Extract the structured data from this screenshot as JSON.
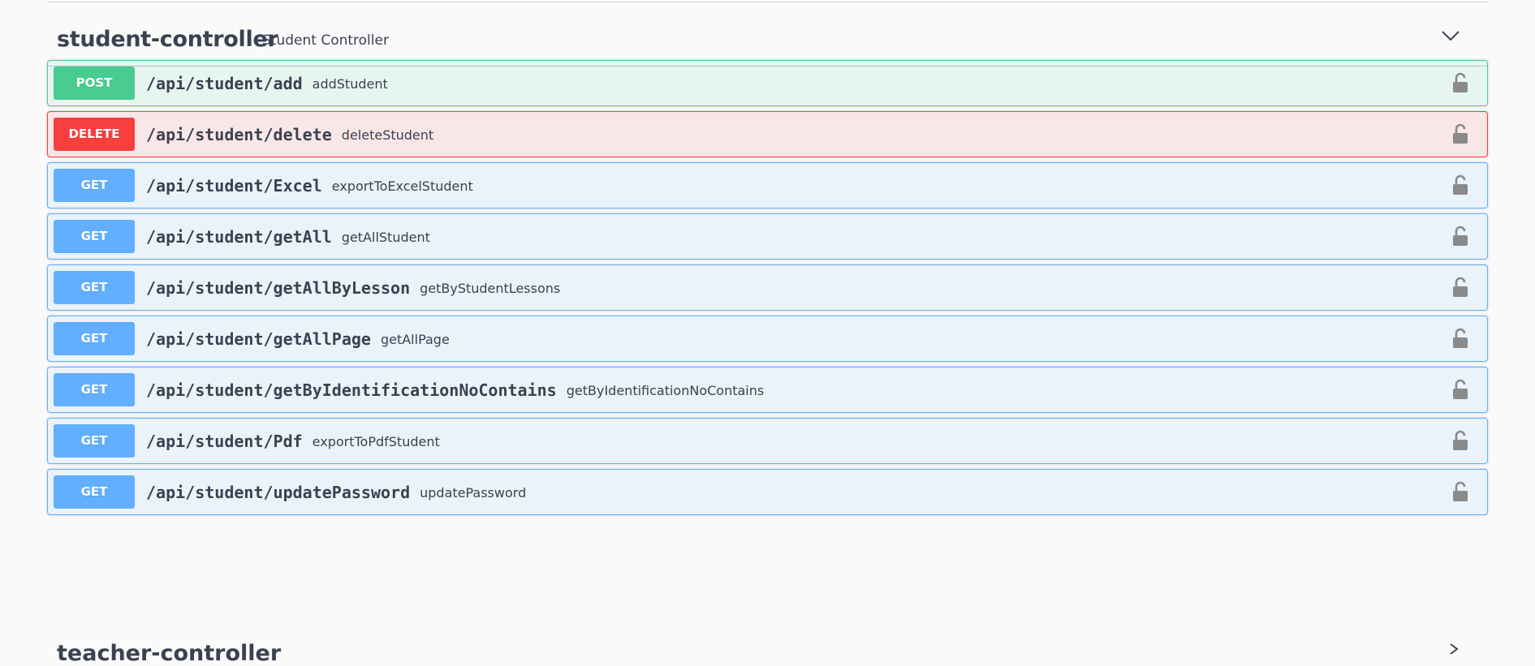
{
  "controller": {
    "name": "student-controller",
    "description": "Student Controller",
    "expanded_icon": "chevron-down-icon"
  },
  "operations": [
    {
      "method": "POST",
      "path": "/api/student/add",
      "summary": "addStudent"
    },
    {
      "method": "DELETE",
      "path": "/api/student/delete",
      "summary": "deleteStudent"
    },
    {
      "method": "GET",
      "path": "/api/student/Excel",
      "summary": "exportToExcelStudent"
    },
    {
      "method": "GET",
      "path": "/api/student/getAll",
      "summary": "getAllStudent"
    },
    {
      "method": "GET",
      "path": "/api/student/getAllByLesson",
      "summary": "getByStudentLessons"
    },
    {
      "method": "GET",
      "path": "/api/student/getAllPage",
      "summary": "getAllPage"
    },
    {
      "method": "GET",
      "path": "/api/student/getByIdentificationNoContains",
      "summary": "getByIdentificationNoContains"
    },
    {
      "method": "GET",
      "path": "/api/student/Pdf",
      "summary": "exportToPdfStudent"
    },
    {
      "method": "GET",
      "path": "/api/student/updatePassword",
      "summary": "updatePassword"
    }
  ],
  "next_controller": {
    "name": "teacher-controller",
    "collapsed_icon": "chevron-right-icon"
  },
  "colors": {
    "post": "#49cc90",
    "delete": "#f93e3e",
    "get": "#61affe",
    "lock_icon": "#8a8a8a"
  }
}
